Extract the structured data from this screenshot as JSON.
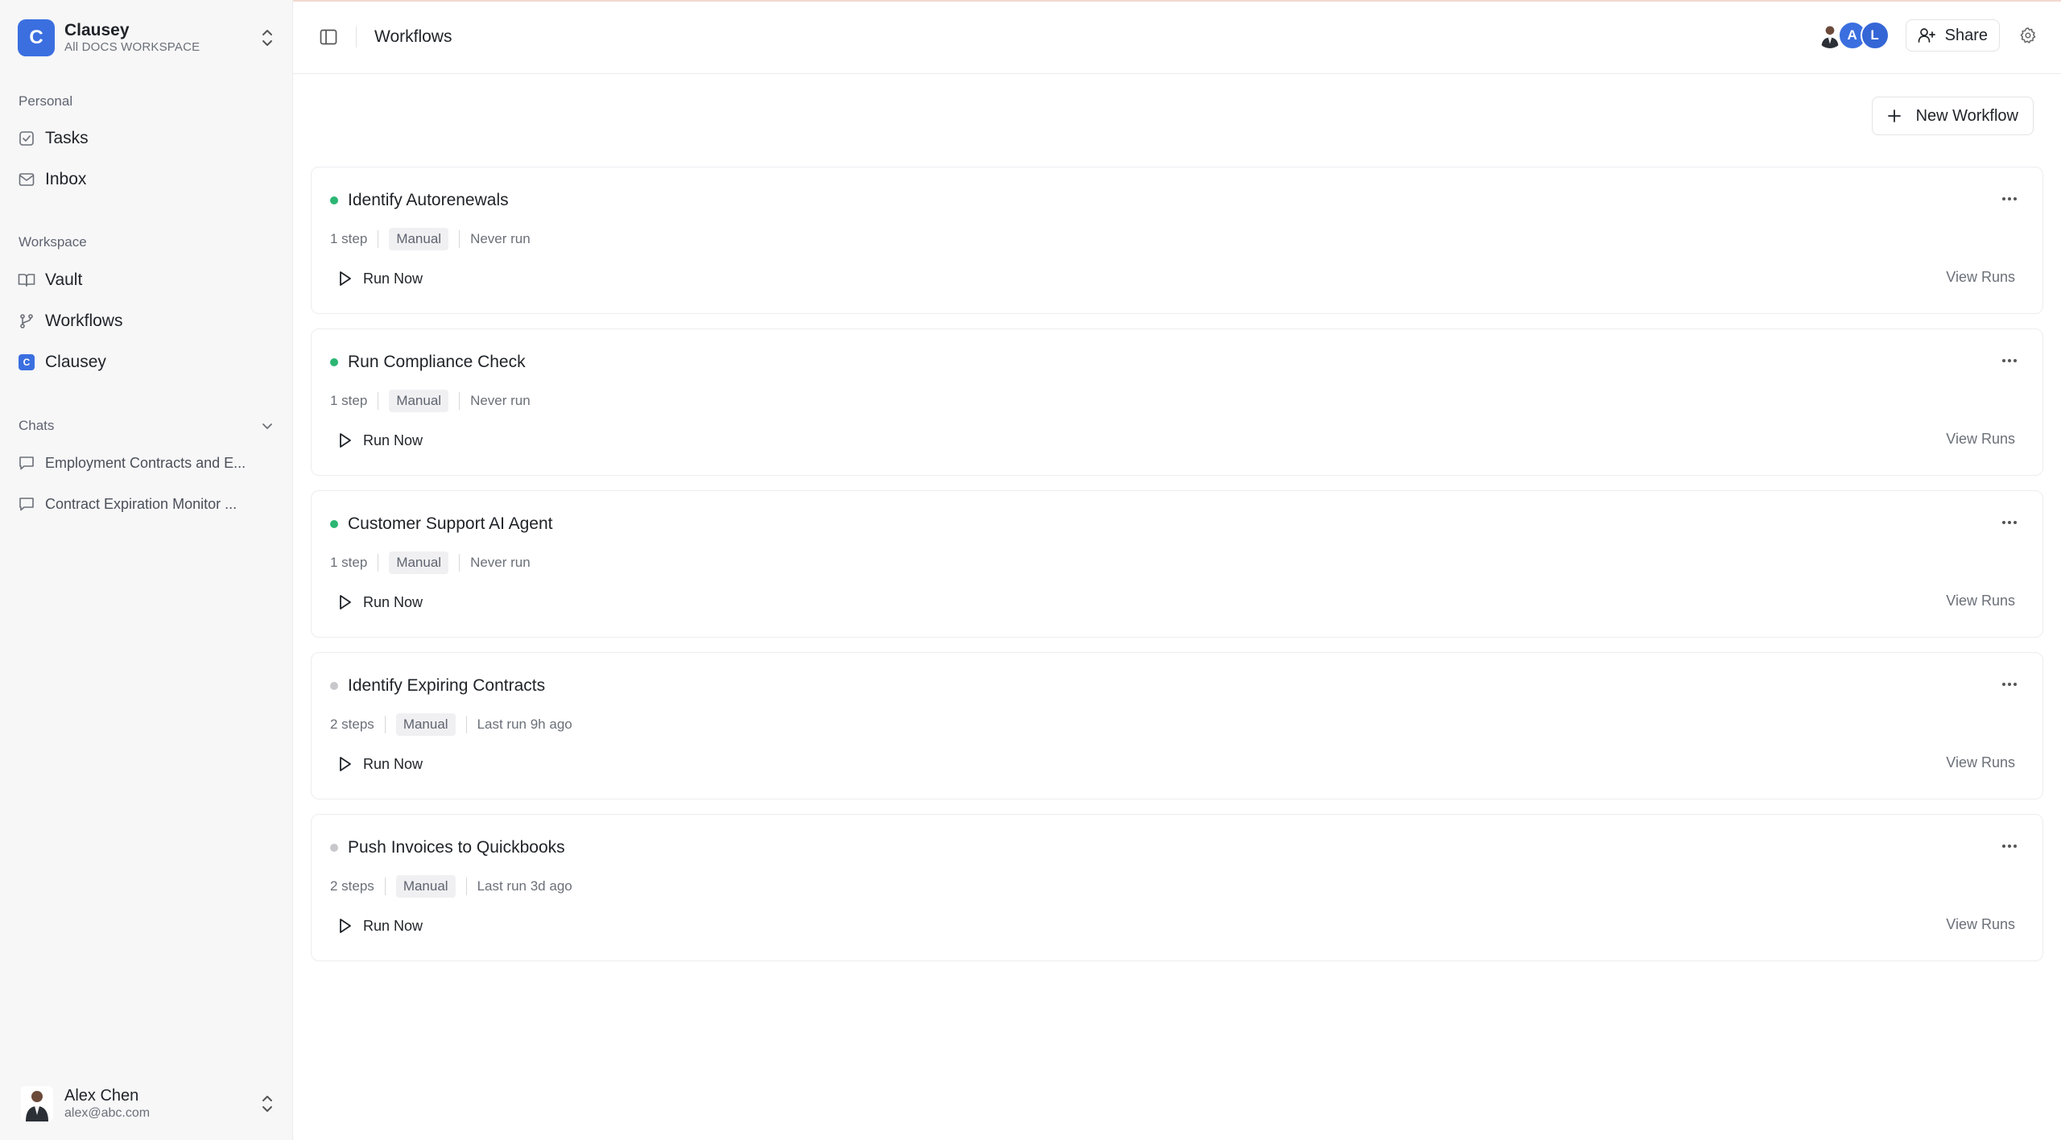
{
  "workspace": {
    "initial": "C",
    "name": "Clausey",
    "subtitle": "All DOCS WORKSPACE"
  },
  "sidebar": {
    "personal_label": "Personal",
    "personal_items": [
      {
        "label": "Tasks",
        "icon": "checkbox-icon"
      },
      {
        "label": "Inbox",
        "icon": "mail-icon"
      }
    ],
    "workspace_label": "Workspace",
    "workspace_items": [
      {
        "label": "Vault",
        "icon": "book-icon"
      },
      {
        "label": "Workflows",
        "icon": "branch-icon"
      },
      {
        "label": "Clausey",
        "icon": "clausey-logo-icon",
        "logo_letter": "C"
      }
    ],
    "chats_label": "Chats",
    "chats": [
      {
        "label": "Employment Contracts and E..."
      },
      {
        "label": "Contract Expiration Monitor ..."
      }
    ]
  },
  "user": {
    "name": "Alex Chen",
    "email": "alex@abc.com"
  },
  "header": {
    "title": "Workflows",
    "avatars": [
      {
        "initial": ""
      },
      {
        "initial": "A"
      },
      {
        "initial": "L"
      }
    ],
    "share_label": "Share"
  },
  "new_workflow_label": "New Workflow",
  "workflows": [
    {
      "title": "Identify Autorenewals",
      "status": "active",
      "steps": "1 step",
      "trigger": "Manual",
      "last_run": "Never run",
      "run_label": "Run Now",
      "view_label": "View Runs"
    },
    {
      "title": "Run Compliance Check",
      "status": "active",
      "steps": "1 step",
      "trigger": "Manual",
      "last_run": "Never run",
      "run_label": "Run Now",
      "view_label": "View Runs"
    },
    {
      "title": "Customer Support AI Agent",
      "status": "active",
      "steps": "1 step",
      "trigger": "Manual",
      "last_run": "Never run",
      "run_label": "Run Now",
      "view_label": "View Runs"
    },
    {
      "title": "Identify Expiring Contracts",
      "status": "inactive",
      "steps": "2 steps",
      "trigger": "Manual",
      "last_run": "Last run 9h ago",
      "run_label": "Run Now",
      "view_label": "View Runs"
    },
    {
      "title": "Push Invoices to Quickbooks",
      "status": "inactive",
      "steps": "2 steps",
      "trigger": "Manual",
      "last_run": "Last run 3d ago",
      "run_label": "Run Now",
      "view_label": "View Runs"
    }
  ],
  "colors": {
    "brand": "#3b6fe0",
    "active_dot": "#2bb673",
    "inactive_dot": "#c8c8cc",
    "avatar_a": "#3b6fe0",
    "avatar_l": "#3566d6"
  }
}
